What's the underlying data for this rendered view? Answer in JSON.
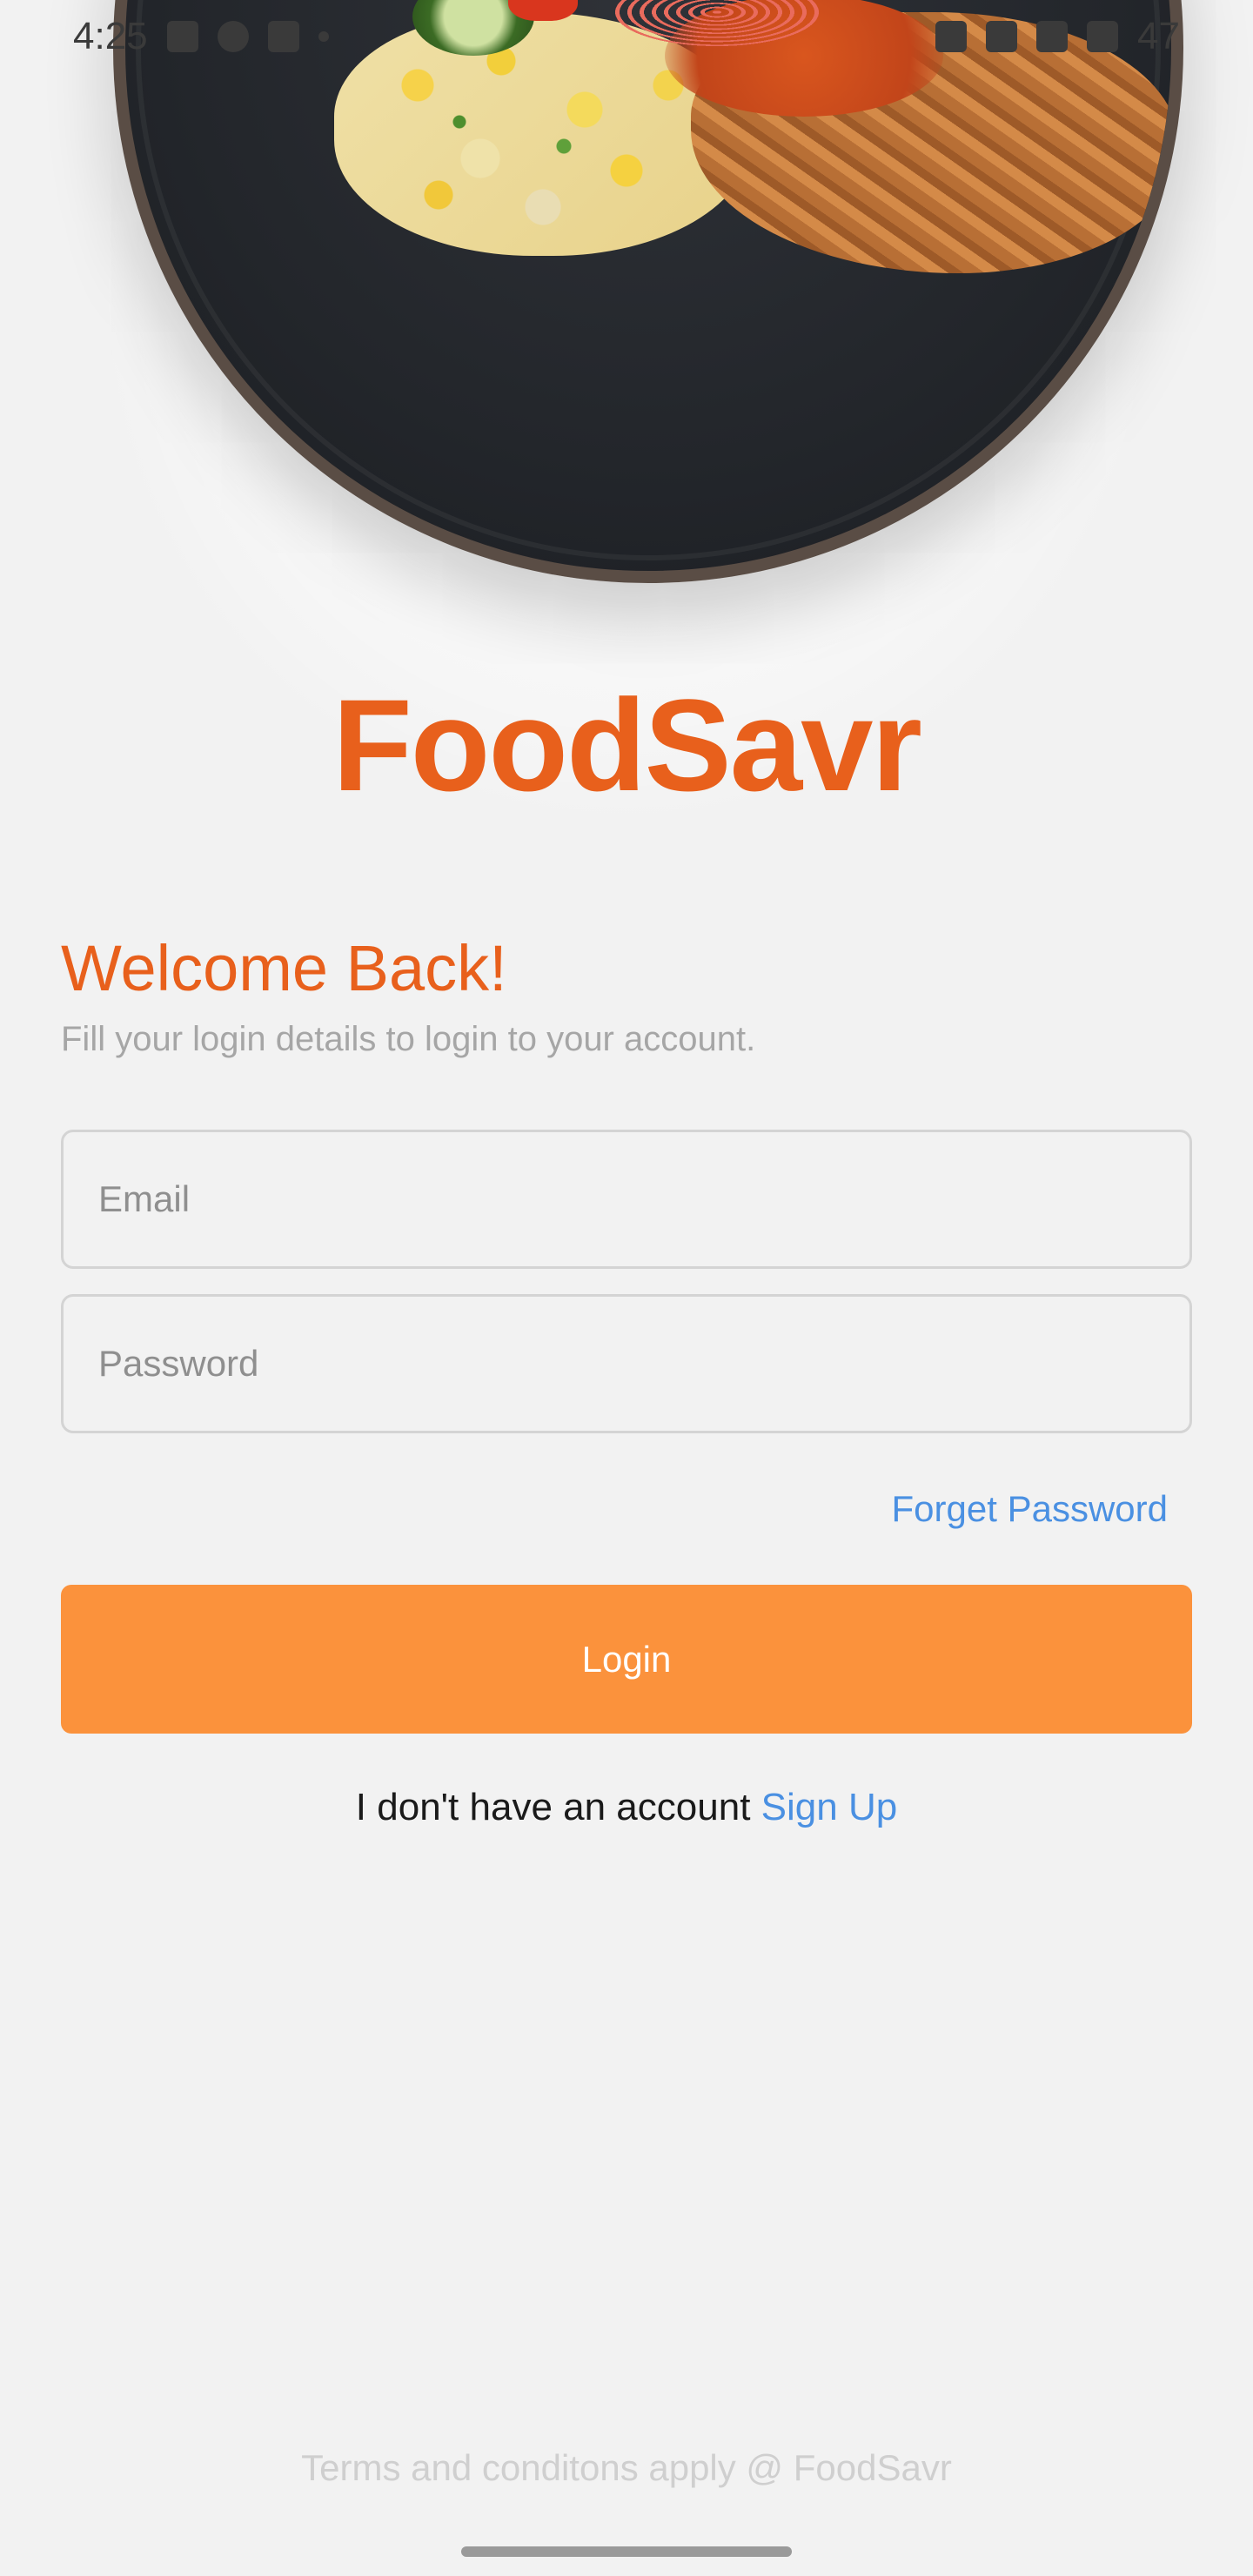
{
  "status_bar": {
    "time": "4:25",
    "battery": "47"
  },
  "brand": {
    "name": "FoodSavr"
  },
  "login": {
    "title": "Welcome Back!",
    "subtitle": "Fill your login details to login to your account.",
    "email_placeholder": "Email",
    "password_placeholder": "Password",
    "forgot_label": "Forget Password",
    "login_label": "Login",
    "no_account_text": "I don't have an account",
    "signup_label": "Sign Up"
  },
  "footer": {
    "terms": "Terms and conditons apply @ FoodSavr"
  },
  "colors": {
    "brand_orange": "#e8601c",
    "button_orange": "#fb923c",
    "link_blue": "#4a90e2",
    "background": "#f2f2f2"
  }
}
